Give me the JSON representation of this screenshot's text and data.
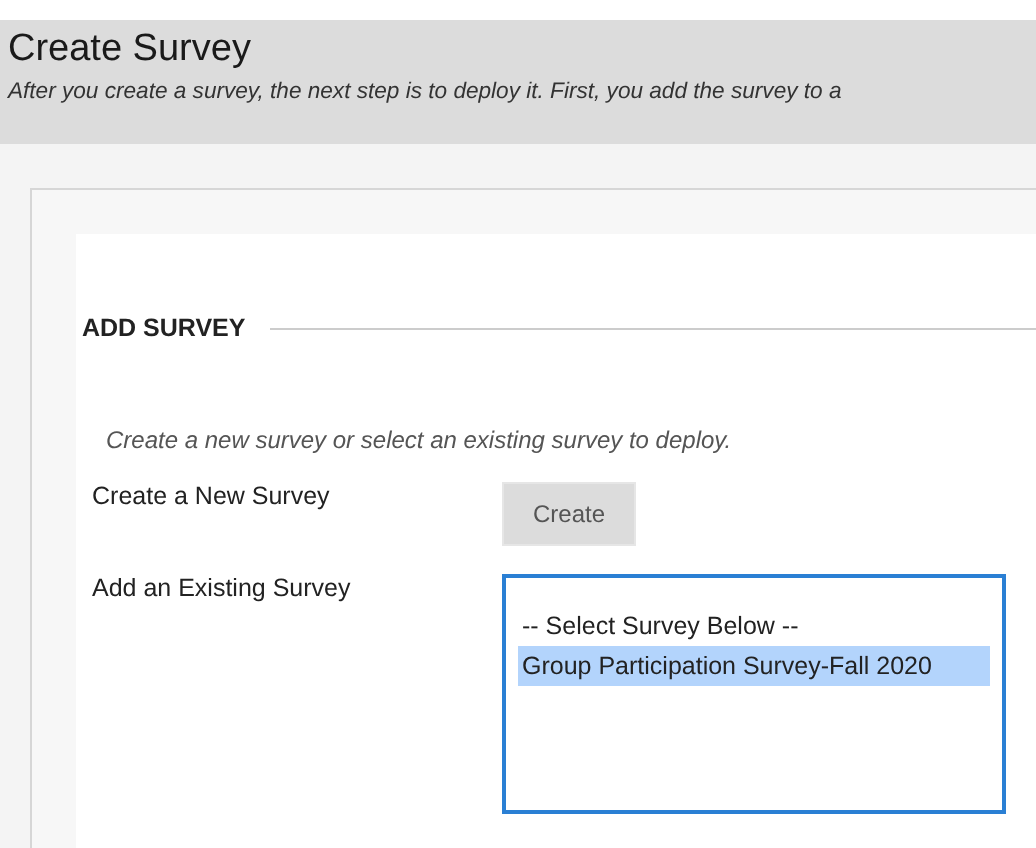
{
  "header": {
    "title": "Create Survey",
    "description": "After you create a survey, the next step is to deploy it. First, you add the survey to a"
  },
  "section": {
    "heading": "ADD SURVEY",
    "instructions": "Create a new survey or select an existing survey to deploy.",
    "fields": [
      {
        "kind": "button",
        "label": "Create a New Survey",
        "button": "Create"
      },
      {
        "kind": "listbox",
        "label": "Add an Existing Survey",
        "options": [
          {
            "label": "-- Select Survey Below --",
            "selected": false
          },
          {
            "label": "Group Participation Survey-Fall 2020",
            "selected": true
          }
        ]
      }
    ]
  }
}
